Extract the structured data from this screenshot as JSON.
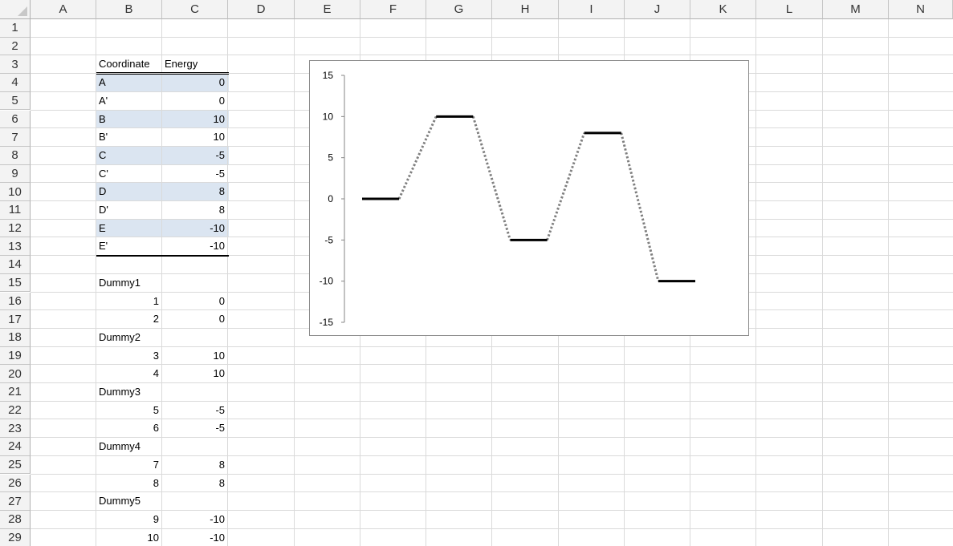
{
  "columns": [
    "A",
    "B",
    "C",
    "D",
    "E",
    "F",
    "G",
    "H",
    "I",
    "J",
    "K",
    "L",
    "M",
    "N"
  ],
  "rows": [
    "1",
    "2",
    "3",
    "4",
    "5",
    "6",
    "7",
    "8",
    "9",
    "10",
    "11",
    "12",
    "13",
    "14",
    "15",
    "16",
    "17",
    "18",
    "19",
    "20",
    "21",
    "22",
    "23",
    "24",
    "25",
    "26",
    "27",
    "28",
    "29"
  ],
  "table": {
    "header": {
      "coordinate": "Coordinate",
      "energy": "Energy"
    },
    "rows": [
      {
        "label": "A",
        "value": "0"
      },
      {
        "label": "A'",
        "value": "0"
      },
      {
        "label": "B",
        "value": "10"
      },
      {
        "label": "B'",
        "value": "10"
      },
      {
        "label": "C",
        "value": "-5"
      },
      {
        "label": "C'",
        "value": "-5"
      },
      {
        "label": "D",
        "value": "8"
      },
      {
        "label": "D'",
        "value": "8"
      },
      {
        "label": "E",
        "value": "-10"
      },
      {
        "label": "E'",
        "value": "-10"
      }
    ]
  },
  "dummies": [
    {
      "name": "Dummy1",
      "rows": [
        [
          "1",
          "0"
        ],
        [
          "2",
          "0"
        ]
      ]
    },
    {
      "name": "Dummy2",
      "rows": [
        [
          "3",
          "10"
        ],
        [
          "4",
          "10"
        ]
      ]
    },
    {
      "name": "Dummy3",
      "rows": [
        [
          "5",
          "-5"
        ],
        [
          "6",
          "-5"
        ]
      ]
    },
    {
      "name": "Dummy4",
      "rows": [
        [
          "7",
          "8"
        ],
        [
          "8",
          "8"
        ]
      ]
    },
    {
      "name": "Dummy5",
      "rows": [
        [
          "9",
          "-10"
        ],
        [
          "10",
          "-10"
        ]
      ]
    }
  ],
  "colors": {
    "band": "#dbe5f1",
    "level_line": "#000000",
    "connector": "#7f7f7f"
  },
  "chart_data": {
    "type": "line",
    "title": "",
    "xlabel": "",
    "ylabel": "",
    "ylim": [
      -15,
      15
    ],
    "yticks": [
      "15",
      "10",
      "5",
      "0",
      "-5",
      "-10",
      "-15"
    ],
    "x_axis_visible": false,
    "grid": false,
    "legend": "none",
    "levels": [
      {
        "name": "Dummy1",
        "x": [
          1,
          2
        ],
        "y": [
          0,
          0
        ]
      },
      {
        "name": "Dummy2",
        "x": [
          3,
          4
        ],
        "y": [
          10,
          10
        ]
      },
      {
        "name": "Dummy3",
        "x": [
          5,
          6
        ],
        "y": [
          -5,
          -5
        ]
      },
      {
        "name": "Dummy4",
        "x": [
          7,
          8
        ],
        "y": [
          8,
          8
        ]
      },
      {
        "name": "Dummy5",
        "x": [
          9,
          10
        ],
        "y": [
          -10,
          -10
        ]
      }
    ],
    "connector": {
      "style": "dotted",
      "x": [
        1,
        2,
        3,
        4,
        5,
        6,
        7,
        8,
        9,
        10
      ],
      "y": [
        0,
        0,
        10,
        10,
        -5,
        -5,
        8,
        8,
        -10,
        -10
      ]
    }
  }
}
